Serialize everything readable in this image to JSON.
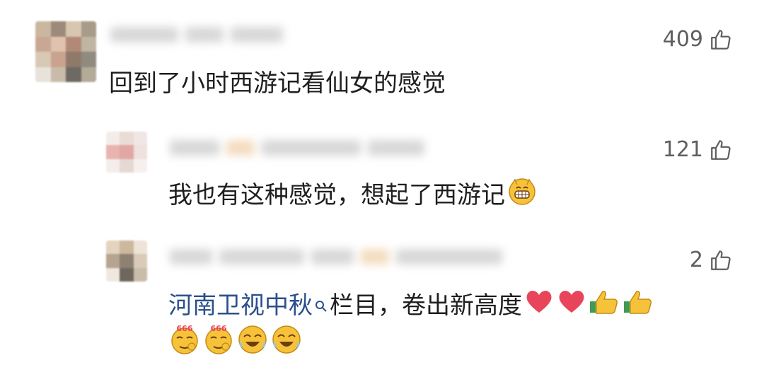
{
  "comments": [
    {
      "text": "回到了小时西游记看仙女的感觉",
      "likes": "409"
    },
    {
      "text": "我也有这种感觉，想起了西游记",
      "likes": "121",
      "emoji": "grin-emoji"
    },
    {
      "link_text": "河南卫视中秋",
      "text": "栏目，卷出新高度",
      "likes": "2",
      "emojis_inline": [
        "heart-emoji",
        "heart-emoji",
        "thumbs-up-emoji",
        "thumbs-up-emoji"
      ],
      "emojis_row": [
        "666-emoji",
        "666-emoji",
        "laugh-cry-emoji",
        "laugh-cry-emoji"
      ],
      "emoji_badge": "666"
    }
  ],
  "colors": {
    "link": "#2b4f8c",
    "like": "#5f5f5f",
    "heart": "#e8455a",
    "emoji_yellow": "#f6c23a"
  }
}
